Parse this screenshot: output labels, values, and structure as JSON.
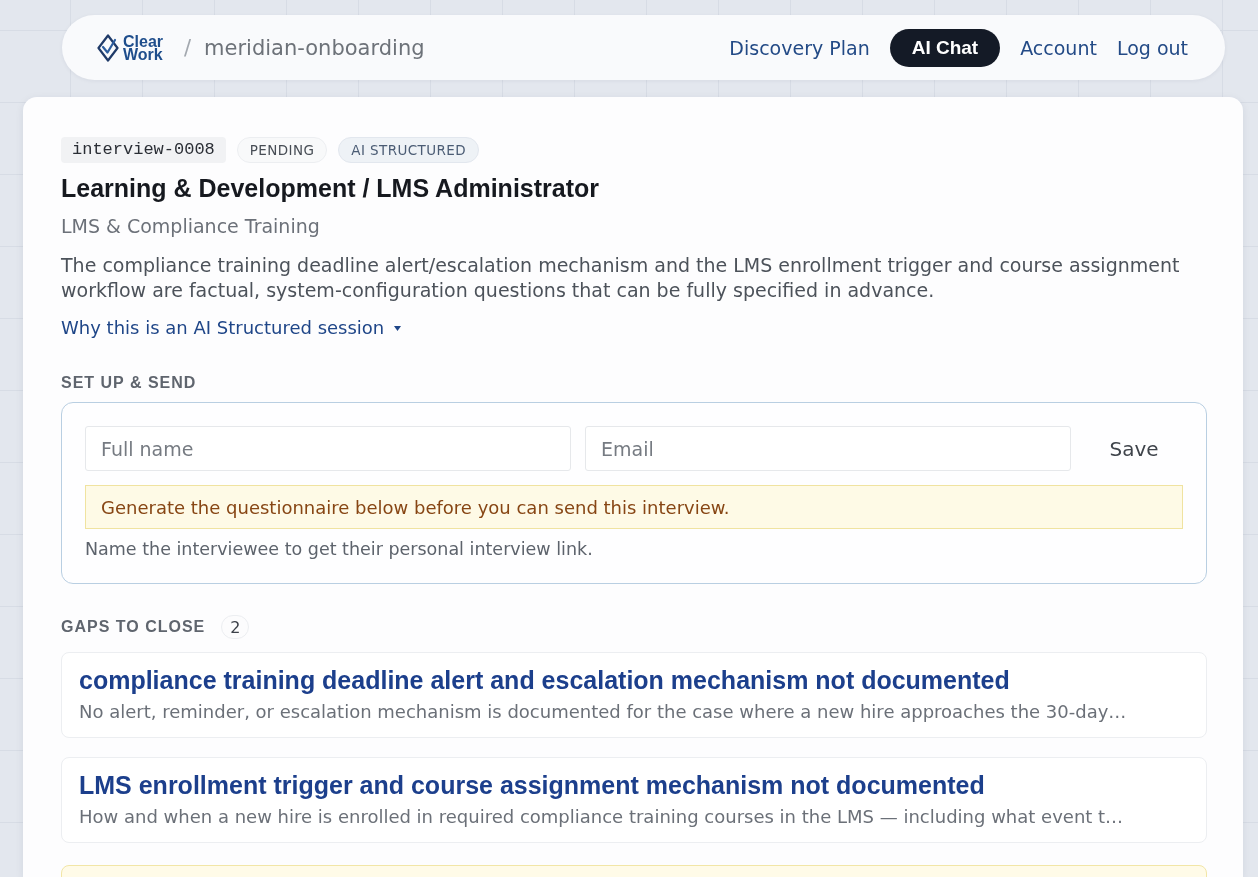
{
  "header": {
    "logo_text": [
      "Clear",
      "Work"
    ],
    "separator": "/",
    "project": "meridian-onboarding",
    "nav": [
      {
        "label": "Discovery Plan",
        "selected": false
      },
      {
        "label": "AI Chat",
        "selected": true
      },
      {
        "label": "Account",
        "selected": false
      },
      {
        "label": "Log out",
        "selected": false
      }
    ]
  },
  "interview": {
    "tags": [
      {
        "kind": "id",
        "label": "interview-0008"
      },
      {
        "kind": "status",
        "label": "PENDING"
      },
      {
        "kind": "mode",
        "label": "AI STRUCTURED"
      }
    ],
    "title": "Learning & Development / LMS Administrator",
    "subtitle": "LMS & Compliance Training",
    "description": "The compliance training deadline alert/escalation mechanism and the LMS enrollment trigger and course assignment workflow are factual, system-configuration questions that can be fully specified in advance.",
    "disclosure": {
      "label": "Why this is an AI Structured session",
      "expanded": false
    }
  },
  "setup": {
    "heading": "SET UP & SEND",
    "fields": [
      {
        "placeholder": "Full name"
      },
      {
        "placeholder": "Email"
      }
    ],
    "save_button": "Save",
    "warning": "Generate the questionnaire below before you can send this interview.",
    "hint": "Name the interviewee to get their personal interview link."
  },
  "gaps": {
    "heading": "GAPS TO CLOSE",
    "count": "2",
    "items": [
      {
        "title": "compliance training deadline alert and escalation mechanism not documented",
        "description": "No alert, reminder, or escalation mechanism is documented for the case where a new hire approaches the 30-day…"
      },
      {
        "title": "LMS enrollment trigger and course assignment mechanism not documented",
        "description": "How and when a new hire is enrolled in required compliance training courses in the LMS — including what event t…"
      }
    ]
  }
}
